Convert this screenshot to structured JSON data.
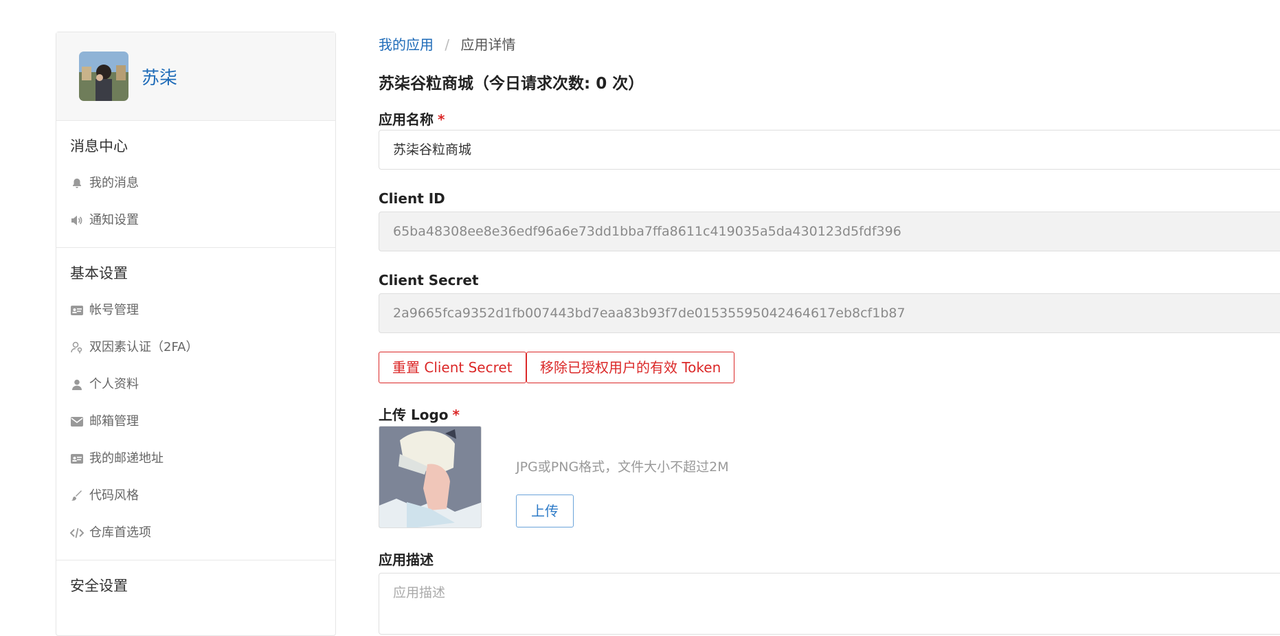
{
  "sidebar": {
    "user_name": "苏柒",
    "sections": [
      {
        "title": "消息中心",
        "items": [
          {
            "label": "我的消息",
            "icon": "bell-icon"
          },
          {
            "label": "通知设置",
            "icon": "volume-icon"
          }
        ]
      },
      {
        "title": "基本设置",
        "items": [
          {
            "label": "帐号管理",
            "icon": "id-card-icon"
          },
          {
            "label": "双因素认证（2FA）",
            "icon": "user-key-icon"
          },
          {
            "label": "个人资料",
            "icon": "user-icon"
          },
          {
            "label": "邮箱管理",
            "icon": "envelope-icon"
          },
          {
            "label": "我的邮递地址",
            "icon": "address-card-icon"
          },
          {
            "label": "代码风格",
            "icon": "paint-brush-icon"
          },
          {
            "label": "仓库首选项",
            "icon": "code-icon"
          }
        ]
      },
      {
        "title": "安全设置",
        "items": []
      }
    ]
  },
  "breadcrumb": {
    "parent": "我的应用",
    "separator": "/",
    "current": "应用详情"
  },
  "page_title": "苏柒谷粒商城（今日请求次数: 0 次）",
  "form": {
    "app_name": {
      "label": "应用名称",
      "required": "*",
      "value": "苏柒谷粒商城"
    },
    "client_id": {
      "label": "Client ID",
      "value": "65ba48308ee8e36edf96a6e73dd1bba7ffa8611c419035a5da430123d5fdf396"
    },
    "client_secret": {
      "label": "Client Secret",
      "value": "2a9665fca9352d1fb007443bd7eaa83b93f7de01535595042464617eb8cf1b87"
    },
    "reset_secret_button": "重置 Client Secret",
    "revoke_tokens_button": "移除已授权用户的有效 Token",
    "logo": {
      "label": "上传 Logo",
      "required": "*",
      "hint": "JPG或PNG格式，文件大小不超过2M",
      "upload_button": "上传"
    },
    "description": {
      "label": "应用描述",
      "placeholder": "应用描述"
    }
  },
  "colors": {
    "link": "#1e6bb8",
    "danger": "#db2828",
    "upload_border": "#6aa3d9"
  }
}
